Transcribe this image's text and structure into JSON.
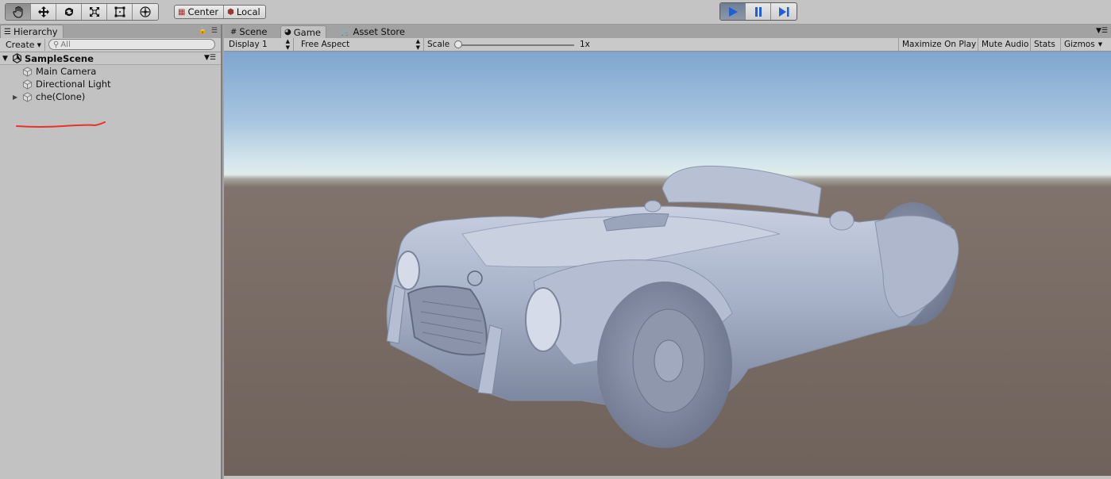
{
  "toolbar": {
    "tools": [
      {
        "name": "hand-tool",
        "icon": "hand-icon",
        "active": true
      },
      {
        "name": "move-tool",
        "icon": "move-icon",
        "active": false
      },
      {
        "name": "rotate-tool",
        "icon": "rotate-icon",
        "active": false
      },
      {
        "name": "scale-tool",
        "icon": "scale-icon",
        "active": false
      },
      {
        "name": "rect-tool",
        "icon": "rect-icon",
        "active": false
      },
      {
        "name": "transform-tool",
        "icon": "transform-icon",
        "active": false
      }
    ],
    "pivot_mode": "Center",
    "pivot_rotation": "Local",
    "play_active": true
  },
  "hierarchy": {
    "tab_label": "Hierarchy",
    "create_label": "Create",
    "search_placeholder": "All",
    "scene_name": "SampleScene",
    "items": [
      {
        "label": "Main Camera",
        "expandable": false
      },
      {
        "label": "Directional Light",
        "expandable": false
      },
      {
        "label": "che(Clone)",
        "expandable": true,
        "annotated": true
      }
    ],
    "annotation_color": "#e8322b"
  },
  "gameview": {
    "tabs": [
      {
        "label": "Scene",
        "icon": "grid-icon",
        "active": false
      },
      {
        "label": "Game",
        "icon": "pacman-icon",
        "active": true
      },
      {
        "label": "Asset Store",
        "icon": "store-icon",
        "active": false
      }
    ],
    "display": "Display 1",
    "aspect": "Free Aspect",
    "scale_label": "Scale",
    "scale_value": "1x",
    "right_buttons": [
      "Maximize On Play",
      "Mute Audio",
      "Stats",
      "Gizmos"
    ],
    "sky_color": "#a6c4df",
    "ground_color": "#6f625b"
  }
}
